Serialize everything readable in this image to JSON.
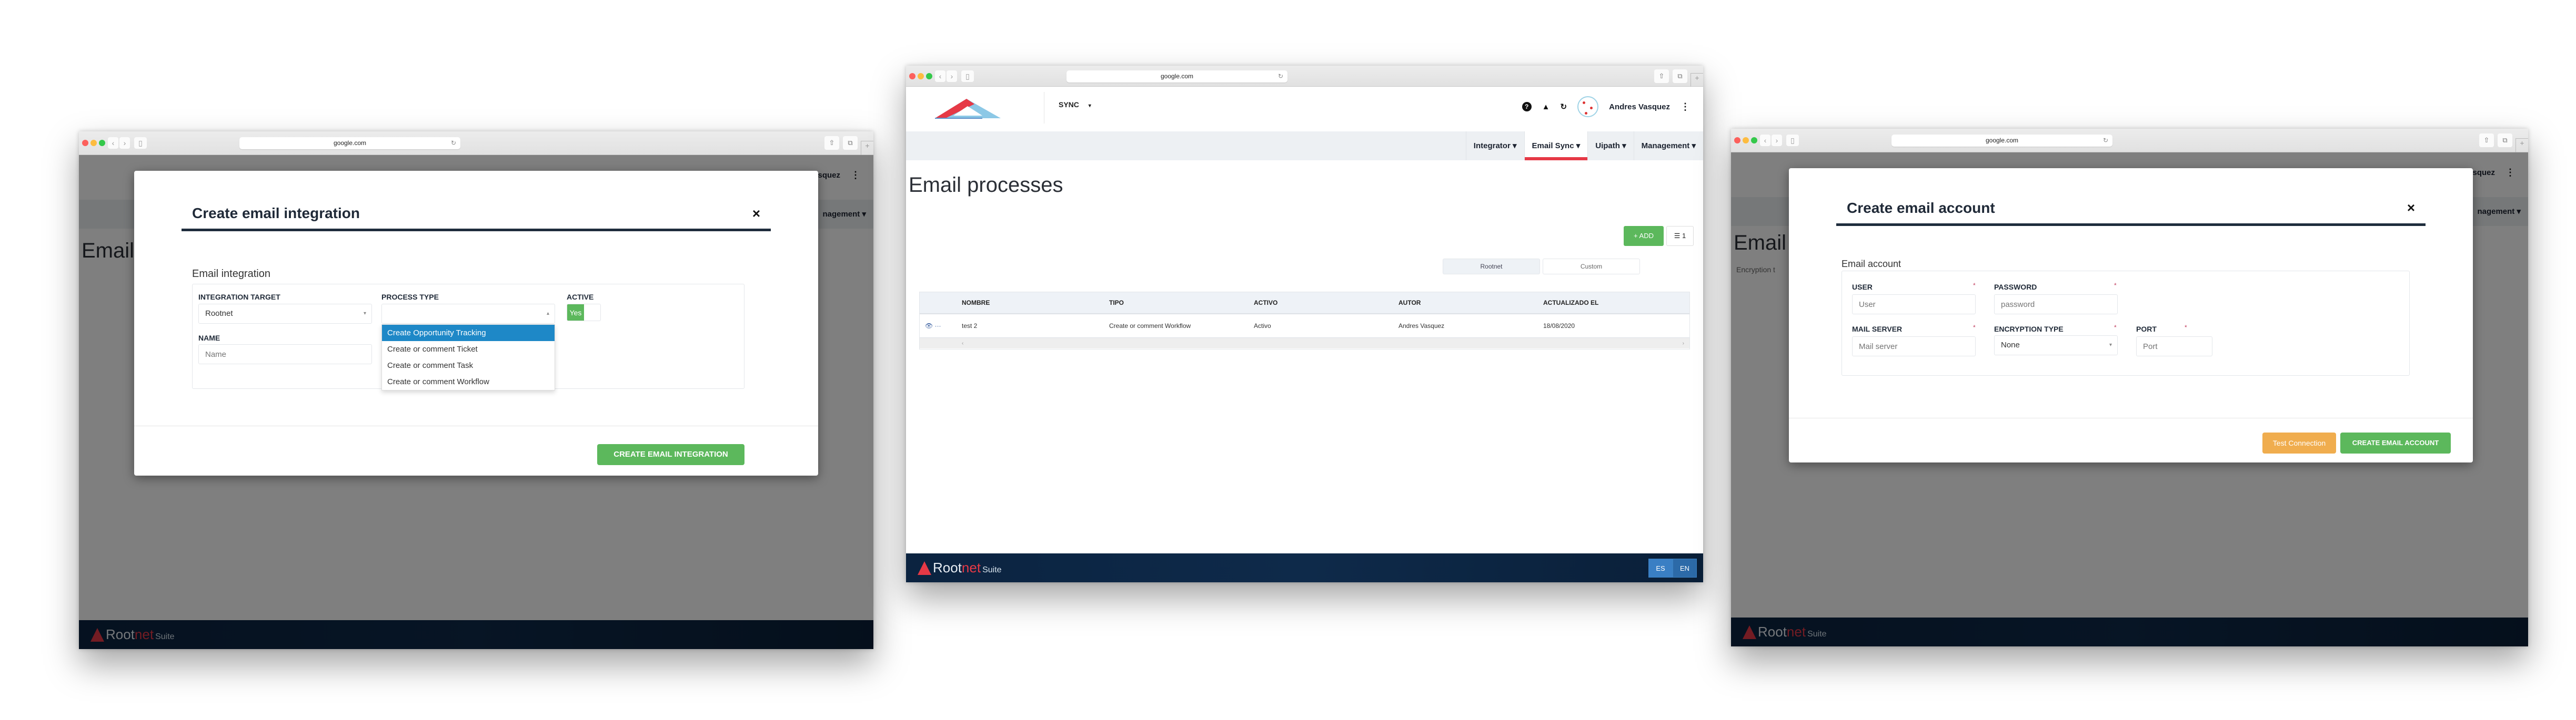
{
  "browser": {
    "url": "google.com",
    "back_icon": "‹",
    "forward_icon": "›",
    "sidebar_icon": "▯",
    "reload_icon": "↻",
    "share_icon": "⇧",
    "tabs_icon": "⧉",
    "new_tab_icon": "+"
  },
  "app": {
    "module_selector": "SYNC",
    "caret": "▾",
    "header_icons": {
      "help": "?",
      "bell": "🔔",
      "refresh": "↻"
    },
    "user_name": "Andres Vasquez",
    "more_icon": "⋮",
    "nav": [
      {
        "label": "Integrator ▾"
      },
      {
        "label": "Email Sync ▾",
        "active": true
      },
      {
        "label": "Uipath ▾"
      },
      {
        "label": "Management ▾"
      }
    ],
    "page_title": "Email processes",
    "add_button": "+ ADD",
    "columns_button": "☰ 1",
    "segments": [
      "Rootnet",
      "Custom"
    ],
    "grid": {
      "headers": [
        "NOMBRE",
        "TIPO",
        "ACTIVO",
        "AUTOR",
        "ACTUALIZADO EL"
      ],
      "rows": [
        {
          "actions": "👁 ···",
          "nombre": "test 2",
          "tipo": "Create or comment Workflow",
          "activo": "Activo",
          "autor": "Andres Vasquez",
          "fecha": "18/08/2020"
        }
      ],
      "scroll_left": "‹",
      "scroll_right": "›"
    },
    "footer": {
      "brand_root": "Root",
      "brand_net": "net",
      "brand_suite": "Suite",
      "languages": [
        "ES",
        "EN"
      ]
    },
    "colors": {
      "accent_red": "#e63946",
      "primary_green": "#5cb85c",
      "warning_orange": "#f0ad4e",
      "select_blue": "#1e88c7",
      "footer_navy": "#0e2a4a"
    }
  },
  "integration_modal": {
    "title": "Create email integration",
    "close": "×",
    "section": "Email integration",
    "integration_target_label": "INTEGRATION TARGET",
    "integration_target_value": "Rootnet",
    "process_type_label": "PROCESS TYPE",
    "process_type_value": "",
    "process_type_options": [
      "Create Opportunity Tracking",
      "Create or comment Ticket",
      "Create or comment Task",
      "Create or comment Workflow"
    ],
    "process_type_highlighted": "Create Opportunity Tracking",
    "active_label": "ACTIVE",
    "active_value": "Yes",
    "name_label": "NAME",
    "name_placeholder": "Name",
    "submit": "CREATE EMAIL INTEGRATION",
    "background_title_fragment": "Email",
    "background_user_fragment": "squez",
    "background_nav_fragment": "nagement ▾"
  },
  "account_modal": {
    "title": "Create email account",
    "close": "×",
    "section": "Email account",
    "user_label": "USER",
    "user_placeholder": "User",
    "password_label": "PASSWORD",
    "password_placeholder": "password",
    "mail_server_label": "MAIL SERVER",
    "mail_server_placeholder": "Mail server",
    "encryption_label": "ENCRYPTION TYPE",
    "encryption_value": "None",
    "port_label": "PORT",
    "port_placeholder": "Port",
    "required_mark": "*",
    "test_button": "Test Connection",
    "submit": "CREATE EMAIL ACCOUNT",
    "background_title_fragment": "Email",
    "background_filter_fragment": "Encryption t",
    "background_user_fragment": "squez",
    "background_nav_fragment": "nagement ▾"
  }
}
